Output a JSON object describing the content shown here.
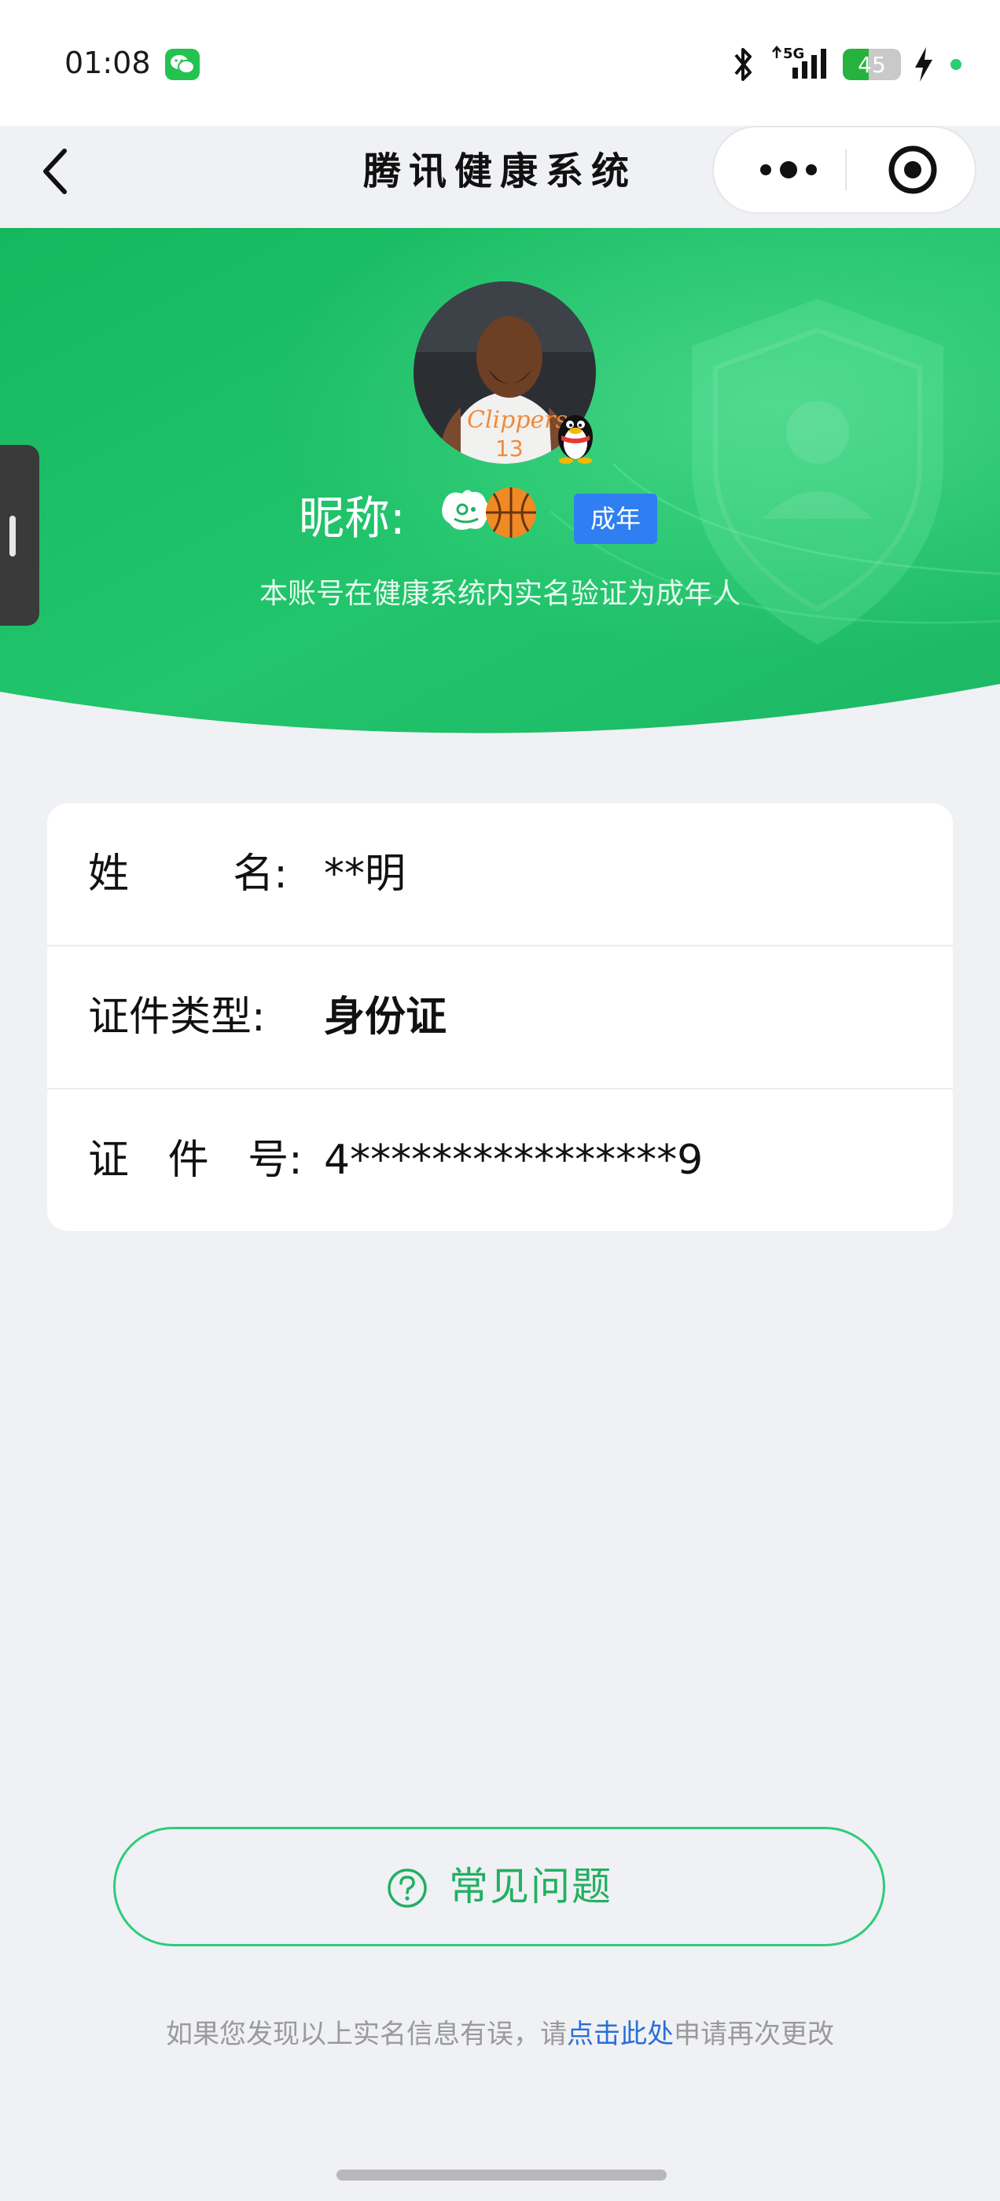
{
  "status_bar": {
    "time": "01:08",
    "network": "5G",
    "battery": 45
  },
  "nav": {
    "title": "腾讯健康系统"
  },
  "profile": {
    "nickname_label": "昵称:",
    "age_tag": "成年",
    "verify_text": "本账号在健康系统内实名验证为成年人"
  },
  "info_rows": [
    {
      "label": "姓        名:",
      "value": "**明"
    },
    {
      "label": "证件类型:",
      "value": "身份证"
    },
    {
      "label": "证   件   号:",
      "value": "4****************9"
    }
  ],
  "faq_button": {
    "label": "常见问题"
  },
  "footer": {
    "prefix": "如果您发现以上实名信息有误，请",
    "link": "点击此处",
    "suffix": "申请再次更改"
  },
  "colors": {
    "brand_green": "#1fc06a",
    "tag_blue": "#2f7ef2",
    "link_blue": "#2a6fd6",
    "page_bg": "#f0f1f4"
  },
  "icons": [
    "wechat-icon",
    "bluetooth-icon",
    "signal-icon",
    "battery-icon",
    "charging-icon",
    "back-arrow-icon",
    "more-icon",
    "target-icon",
    "qq-penguin-icon",
    "help-circle-icon"
  ]
}
